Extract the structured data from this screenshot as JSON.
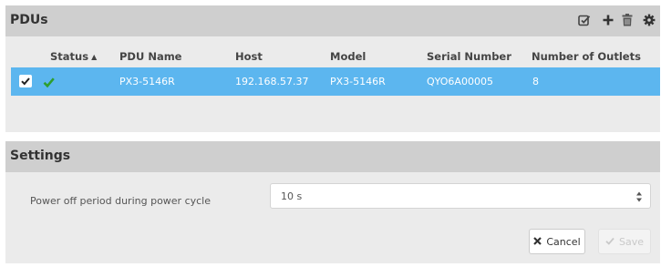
{
  "pdus": {
    "title": "PDUs",
    "toolbar": [
      {
        "name": "edit-icon"
      },
      {
        "name": "add-icon"
      },
      {
        "name": "delete-icon"
      },
      {
        "name": "settings-gear-icon"
      }
    ],
    "columns": [
      "Status",
      "PDU Name",
      "Host",
      "Model",
      "Serial Number",
      "Number of Outlets"
    ],
    "sort_indicator": "▲",
    "rows": [
      {
        "selected": true,
        "status": "ok-checkmark-icon",
        "pdu_name": "PX3-5146R",
        "host": "192.168.57.37",
        "model": "PX3-5146R",
        "serial_number": "QYO6A00005",
        "number_of_outlets": "8"
      }
    ]
  },
  "settings": {
    "title": "Settings",
    "power_off_label": "Power off period during power cycle",
    "power_off_value": "10 s",
    "cancel_label": "Cancel",
    "save_label": "Save"
  },
  "colors": {
    "header_bg": "#cfcfcf",
    "panel_bg": "#ebebeb",
    "selected_row": "#5cb6ef",
    "status_ok": "#2e9e2e"
  }
}
